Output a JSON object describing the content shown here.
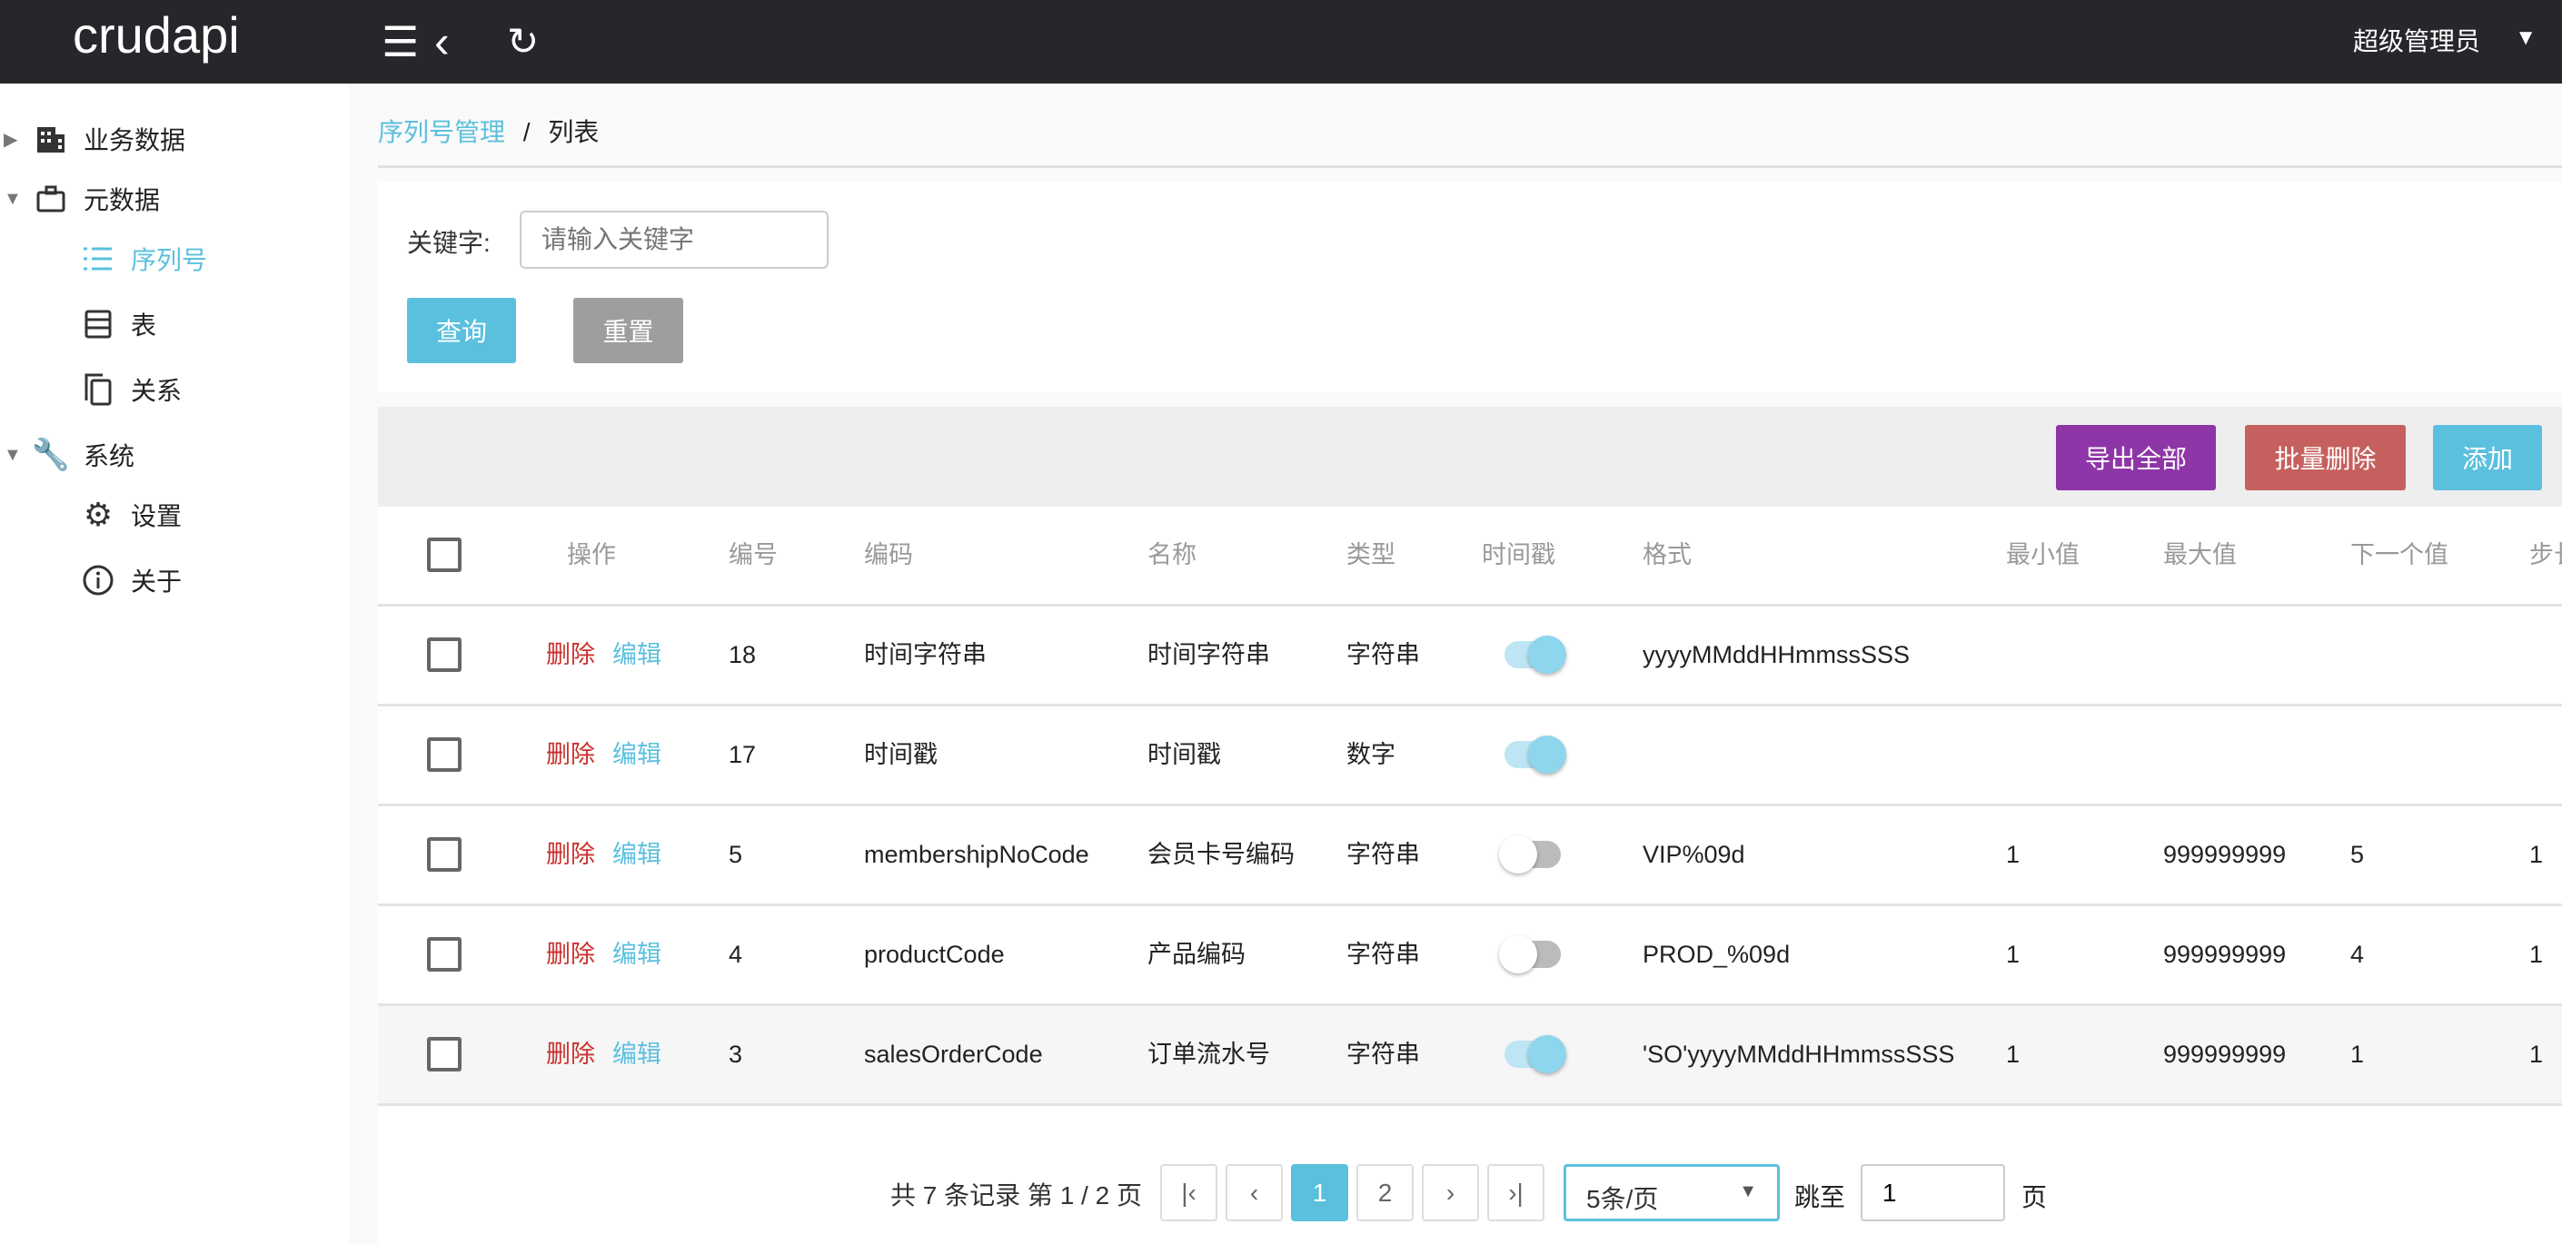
{
  "app": {
    "logo": "crudapi",
    "user": "超级管理员"
  },
  "sidebar": {
    "items": [
      {
        "label": "业务数据",
        "icon": "building-icon"
      },
      {
        "label": "元数据",
        "icon": "briefcase-icon"
      },
      {
        "label": "序列号",
        "icon": "list-icon"
      },
      {
        "label": "表",
        "icon": "table-icon"
      },
      {
        "label": "关系",
        "icon": "copy-icon"
      },
      {
        "label": "系统",
        "icon": "wrench-icon"
      },
      {
        "label": "设置",
        "icon": "gear-icon"
      },
      {
        "label": "关于",
        "icon": "info-icon"
      }
    ]
  },
  "breadcrumb": {
    "parent": "序列号管理",
    "sep": "/",
    "current": "列表"
  },
  "search": {
    "label": "关键字:",
    "placeholder": "请输入关键字",
    "query": "查询",
    "reset": "重置"
  },
  "toolbar": {
    "export": "导出全部",
    "batch_delete": "批量删除",
    "add": "添加"
  },
  "colors": {
    "primary": "#5bc0de",
    "export": "#8e35a8",
    "danger": "#c5605e",
    "reset": "#9e9e9e"
  },
  "table": {
    "headers": {
      "op": "操作",
      "id": "编号",
      "code": "编码",
      "name": "名称",
      "type": "类型",
      "ts": "时间戳",
      "fmt": "格式",
      "min": "最小值",
      "max": "最大值",
      "next": "下一个值",
      "step": "步长"
    },
    "del": "删除",
    "edit": "编辑",
    "rows": [
      {
        "id": "18",
        "code": "时间字符串",
        "name": "时间字符串",
        "type": "字符串",
        "ts": true,
        "fmt": "yyyyMMddHHmmssSSS",
        "min": "",
        "max": "",
        "next": "",
        "step": ""
      },
      {
        "id": "17",
        "code": "时间戳",
        "name": "时间戳",
        "type": "数字",
        "ts": true,
        "fmt": "",
        "min": "",
        "max": "",
        "next": "",
        "step": ""
      },
      {
        "id": "5",
        "code": "membershipNoCode",
        "name": "会员卡号编码",
        "type": "字符串",
        "ts": false,
        "fmt": "VIP%09d",
        "min": "1",
        "max": "999999999",
        "next": "5",
        "step": "1"
      },
      {
        "id": "4",
        "code": "productCode",
        "name": "产品编码",
        "type": "字符串",
        "ts": false,
        "fmt": "PROD_%09d",
        "min": "1",
        "max": "999999999",
        "next": "4",
        "step": "1"
      },
      {
        "id": "3",
        "code": "salesOrderCode",
        "name": "订单流水号",
        "type": "字符串",
        "ts": true,
        "fmt": "'SO'yyyyMMddHHmmssSSS",
        "min": "1",
        "max": "999999999",
        "next": "1",
        "step": "1"
      }
    ]
  },
  "pagination": {
    "summary": "共 7 条记录 第 1 / 2 页",
    "pages": [
      "1",
      "2"
    ],
    "current": "1",
    "page_size": "5条/页",
    "jump_label": "跳至",
    "jump_value": "1",
    "page_suffix": "页"
  }
}
